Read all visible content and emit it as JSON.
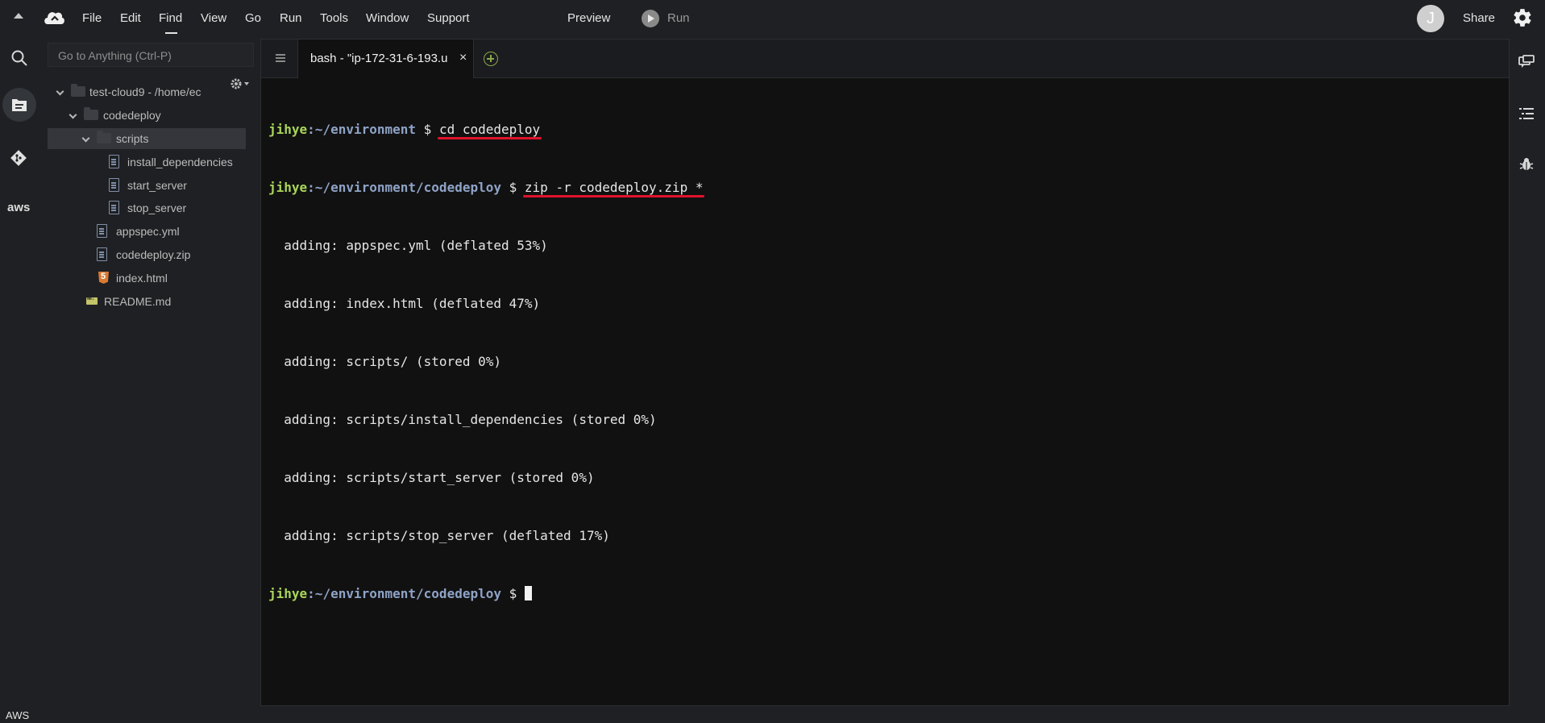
{
  "menubar": {
    "items": [
      "File",
      "Edit",
      "Find",
      "View",
      "Go",
      "Run",
      "Tools",
      "Window",
      "Support"
    ],
    "preview_label": "Preview",
    "run_label": "Run",
    "avatar_initial": "J",
    "share_label": "Share"
  },
  "sidebar": {
    "goto_placeholder": "Go to Anything (Ctrl-P)",
    "tree": [
      {
        "label": "test-cloud9 - /home/ec",
        "type": "folder",
        "expanded": true
      },
      {
        "label": "codedeploy",
        "type": "folder",
        "expanded": true
      },
      {
        "label": "scripts",
        "type": "folder",
        "expanded": true,
        "selected": true
      },
      {
        "label": "install_dependencies",
        "type": "file"
      },
      {
        "label": "start_server",
        "type": "file"
      },
      {
        "label": "stop_server",
        "type": "file"
      },
      {
        "label": "appspec.yml",
        "type": "file"
      },
      {
        "label": "codedeploy.zip",
        "type": "zip"
      },
      {
        "label": "index.html",
        "type": "html"
      },
      {
        "label": "README.md",
        "type": "markdown"
      }
    ],
    "bottom_label": "AWS",
    "aws_rail_label": "aws"
  },
  "terminal": {
    "tab_label": "bash - \"ip-172-31-6-193.u",
    "tab_close": "×",
    "user": "jihye",
    "lines": [
      {
        "path": ":~/environment",
        "prompt": " $ ",
        "cmd": "cd codedeploy"
      },
      {
        "path": ":~/environment/codedeploy",
        "prompt": " $ ",
        "cmd": "zip -r codedeploy.zip *"
      }
    ],
    "output": [
      "  adding: appspec.yml (deflated 53%)",
      "  adding: index.html (deflated 47%)",
      "  adding: scripts/ (stored 0%)",
      "  adding: scripts/install_dependencies (stored 0%)",
      "  adding: scripts/start_server (stored 0%)",
      "  adding: scripts/stop_server (deflated 17%)"
    ],
    "final_prompt_path": ":~/environment/codedeploy",
    "final_prompt": " $ "
  },
  "colors": {
    "prompt_user": "#a9d55a",
    "prompt_path": "#8fa3c7",
    "annotation_underline": "#e0132b",
    "background": "#1f2023",
    "terminal_bg": "#111111"
  }
}
